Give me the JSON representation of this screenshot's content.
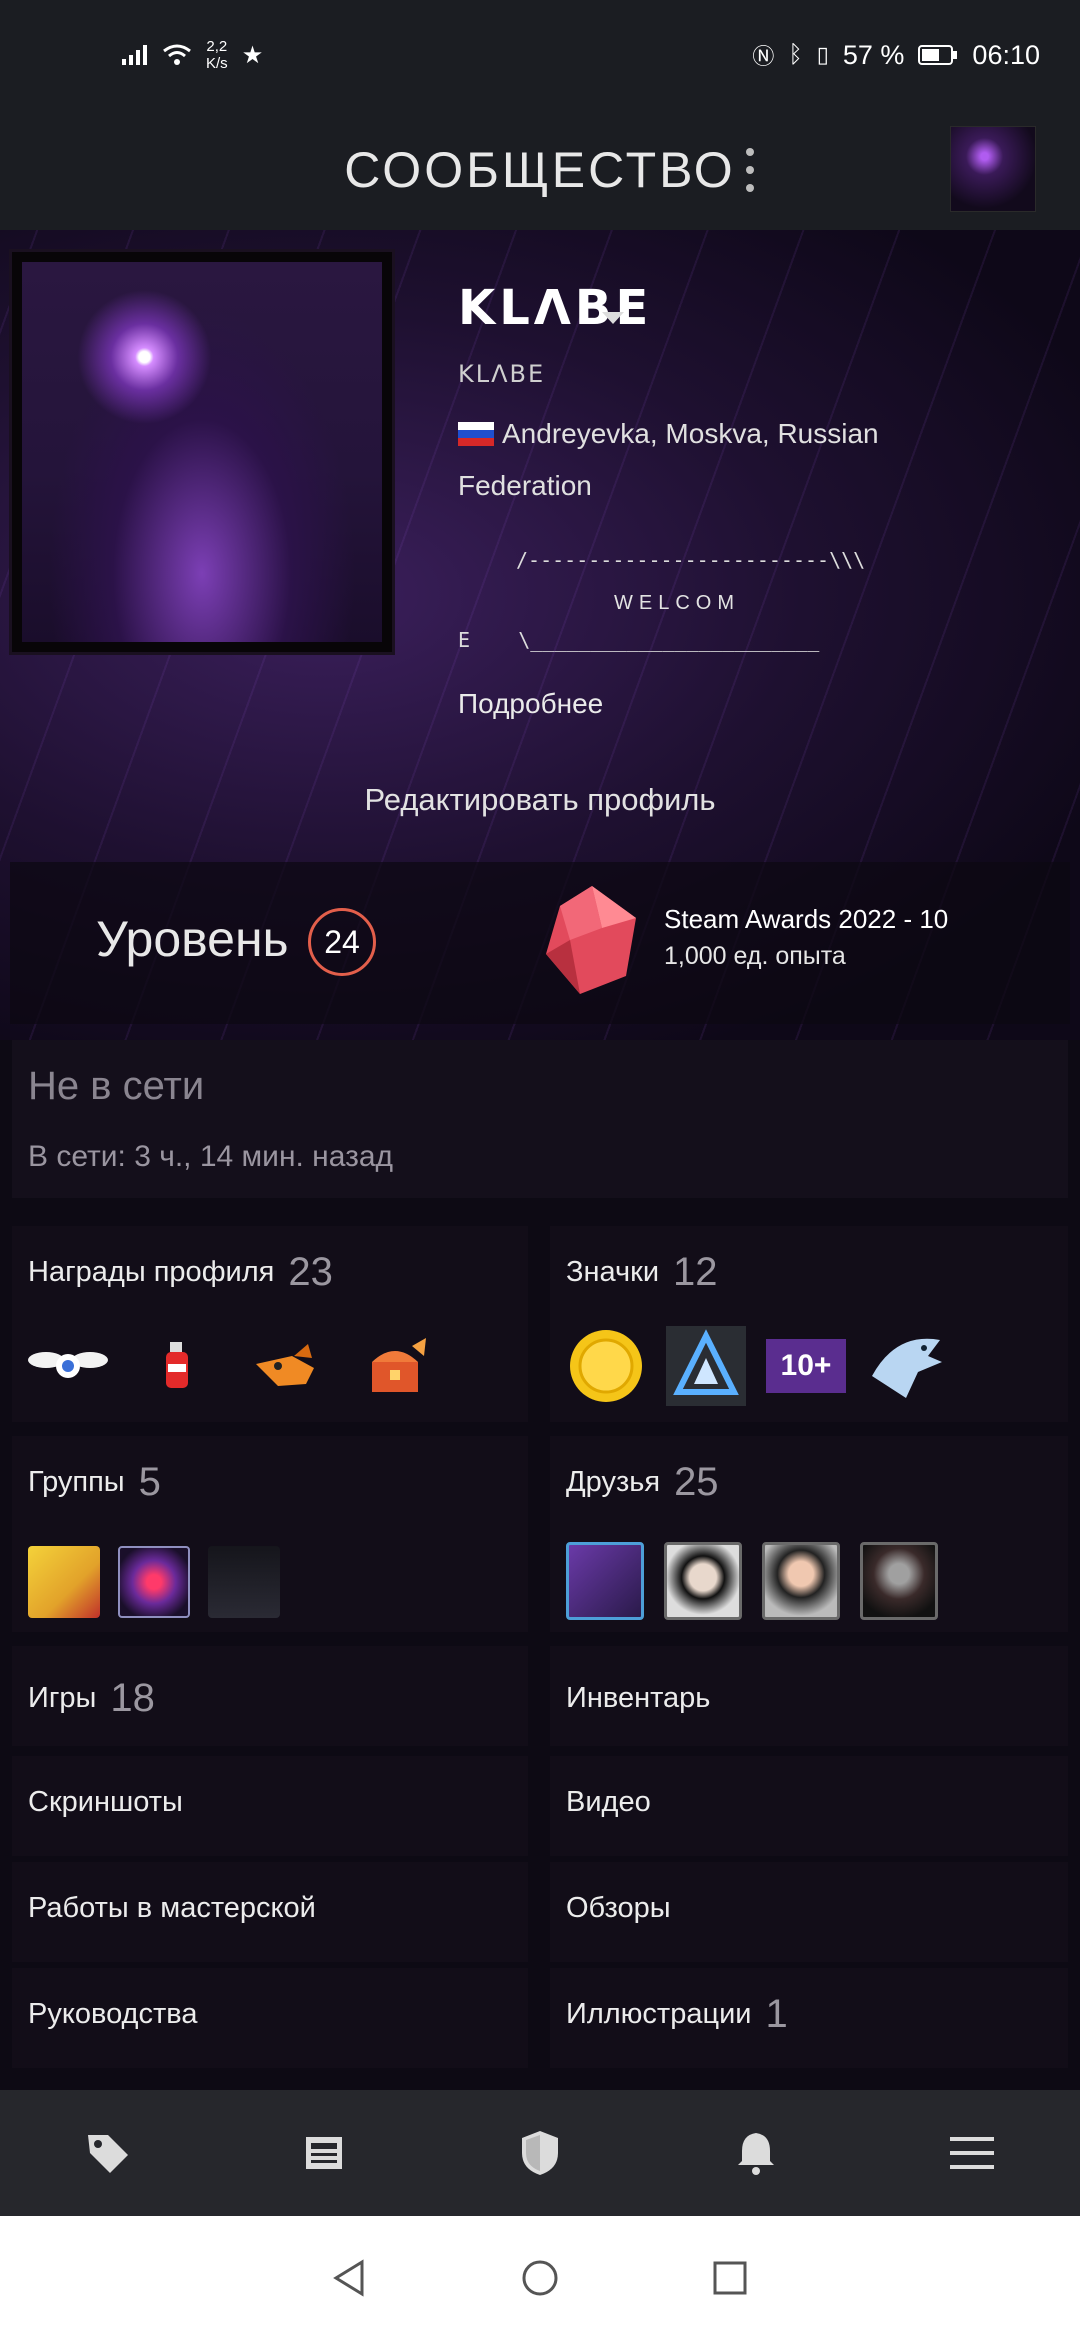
{
  "status_bar": {
    "speed_value": "2,2",
    "speed_unit": "K/s",
    "battery": "57 %",
    "time": "06:10"
  },
  "header": {
    "title": "СООБЩЕСТВО"
  },
  "profile": {
    "username": "KLΛBE",
    "alias": "KLΛBE",
    "location": "Andreyevka, Moskva, Russian Federation",
    "ascii_line1": "/-------------------------\\\\\\",
    "ascii_welcome": "WELCOM",
    "ascii_line2": "E    \\________________________",
    "more_link": "Подробнее",
    "edit_profile": "Редактировать профиль"
  },
  "level": {
    "label": "Уровень",
    "value": "24",
    "xp_title": "Steam Awards 2022 - 10",
    "xp_sub": "1,000 ед. опыта"
  },
  "status": {
    "main": "Не в сети",
    "sub": "В сети: 3 ч., 14 мин. назад"
  },
  "sections": {
    "rewards": {
      "title": "Награды профиля",
      "count": "23"
    },
    "badges": {
      "title": "Значки",
      "count": "12"
    },
    "groups": {
      "title": "Группы",
      "count": "5"
    },
    "friends": {
      "title": "Друзья",
      "count": "25"
    },
    "games": {
      "title": "Игры",
      "count": "18"
    },
    "inventory": {
      "title": "Инвентарь"
    },
    "screenshots": {
      "title": "Скриншоты"
    },
    "videos": {
      "title": "Видео"
    },
    "workshop": {
      "title": "Работы в мастерской"
    },
    "reviews": {
      "title": "Обзоры"
    },
    "guides": {
      "title": "Руководства"
    },
    "artwork": {
      "title": "Иллюстрации",
      "count": "1"
    }
  },
  "badge_labels": {
    "tenplus": "10+"
  },
  "bottom_nav": [
    "tag-icon",
    "news-icon",
    "shield-icon",
    "bell-icon",
    "menu-icon"
  ],
  "colors": {
    "accent_level": "#e35f4b",
    "background": "#0d0a14",
    "card": "#120d18"
  }
}
